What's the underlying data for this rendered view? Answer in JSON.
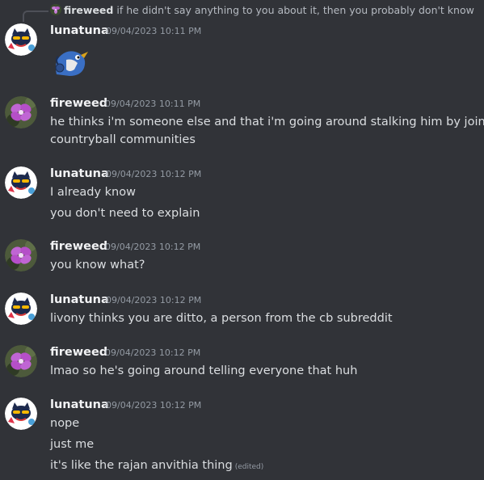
{
  "reply": {
    "author": "fireweed",
    "text": "if he didn't say anything to you about it, then you probably don't know"
  },
  "messages": [
    {
      "author": "lunatuna",
      "timestamp": "09/04/2023 10:11 PM",
      "avatar_icon": "cat-avatar-icon",
      "lines": [],
      "sticker": "blue-bird-sticker-icon"
    },
    {
      "author": "fireweed",
      "timestamp": "09/04/2023 10:11 PM",
      "avatar_icon": "flower-avatar-icon",
      "lines": [
        "he thinks i'm someone else and that i'm going around stalking him by joining",
        "countryball communities"
      ]
    },
    {
      "author": "lunatuna",
      "timestamp": "09/04/2023 10:12 PM",
      "avatar_icon": "cat-avatar-icon",
      "lines": [
        "I already know",
        "you don't need to explain"
      ]
    },
    {
      "author": "fireweed",
      "timestamp": "09/04/2023 10:12 PM",
      "avatar_icon": "flower-avatar-icon",
      "lines": [
        "you know what?"
      ]
    },
    {
      "author": "lunatuna",
      "timestamp": "09/04/2023 10:12 PM",
      "avatar_icon": "cat-avatar-icon",
      "lines": [
        "livony thinks you are ditto, a person from the cb subreddit"
      ]
    },
    {
      "author": "fireweed",
      "timestamp": "09/04/2023 10:12 PM",
      "avatar_icon": "flower-avatar-icon",
      "lines": [
        "lmao so he's going around telling everyone that huh"
      ]
    },
    {
      "author": "lunatuna",
      "timestamp": "09/04/2023 10:12 PM",
      "avatar_icon": "cat-avatar-icon",
      "lines": [
        "nope",
        "just me",
        "it's like the rajan anvithia thing"
      ],
      "edited_label": "(edited)"
    }
  ],
  "colors": {
    "background": "#313338",
    "username": "#f2f3f5",
    "timestamp": "#949ba4",
    "message_text": "#dbdee1"
  }
}
